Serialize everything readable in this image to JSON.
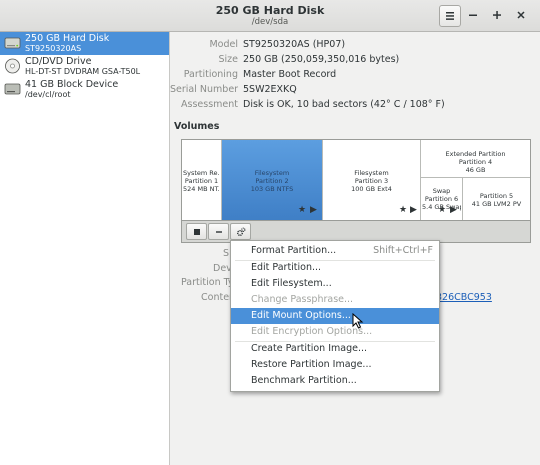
{
  "titlebar": {
    "title": "250 GB Hard Disk",
    "subtitle": "/dev/sda",
    "menu_icon": "hamburger-icon",
    "minimize_icon": "minimize-icon",
    "maximize_icon": "maximize-icon",
    "close_icon": "close-icon"
  },
  "sidebar": {
    "drives": [
      {
        "name": "250 GB Hard Disk",
        "sub": "ST9250320AS",
        "icon": "hard-disk-icon",
        "selected": true
      },
      {
        "name": "CD/DVD Drive",
        "sub": "HL-DT-ST DVDRAM GSA-T50L",
        "icon": "optical-disc-icon"
      },
      {
        "name": "41 GB Block Device",
        "sub": "/dev/cl/root",
        "icon": "block-device-icon"
      }
    ]
  },
  "drive_info": {
    "model_label": "Model",
    "model": "ST9250320AS (HP07)",
    "size_label": "Size",
    "size": "250 GB (250,059,350,016 bytes)",
    "partitioning_label": "Partitioning",
    "partitioning": "Master Boot Record",
    "serial_label": "Serial Number",
    "serial": "5SW2EXKQ",
    "assessment_label": "Assessment",
    "assessment": "Disk is OK, 10 bad sectors (42° C / 108° F)"
  },
  "volumes": {
    "heading": "Volumes",
    "partitions": [
      {
        "line1": "System Re...",
        "line2": "Partition 1",
        "line3": "524 MB NT..."
      },
      {
        "line1": "Filesystem",
        "line2": "Partition 2",
        "line3": "103 GB NTFS",
        "selected": true
      },
      {
        "line1": "Filesystem",
        "line2": "Partition 3",
        "line3": "100 GB Ext4"
      },
      {
        "line1": "Extended Partition",
        "line2": "Partition 4",
        "line3": "46 GB"
      },
      {
        "line1": "Swap",
        "line2": "Partition 6",
        "line3": "5.4 GB Swap"
      },
      {
        "line1": "Partition 5",
        "line2": "41 GB LVM2 PV"
      }
    ],
    "tools": {
      "stop_icon": "stop-icon",
      "remove_icon": "minus-icon",
      "settings_icon": "gears-icon"
    }
  },
  "partition_info": {
    "size_label_partial": "S",
    "device_label_partial": "Devi",
    "type_label_partial": "Partition Ty",
    "contents_label_partial": "Conter",
    "uuid_partial": "326CBC953"
  },
  "context_menu": {
    "items": [
      {
        "label": "Format Partition...",
        "accel": "Shift+Ctrl+F"
      },
      {
        "label": "Edit Partition..."
      },
      {
        "label": "Edit Filesystem..."
      },
      {
        "label": "Change Passphrase...",
        "disabled": true
      },
      {
        "label": "Edit Mount Options...",
        "highlighted": true
      },
      {
        "label": "Edit Encryption Options...",
        "disabled": true
      },
      {
        "label": "Create Partition Image..."
      },
      {
        "label": "Restore Partition Image..."
      },
      {
        "label": "Benchmark Partition..."
      }
    ]
  },
  "colors": {
    "accent": "#4a90d9",
    "selected_partition": "#3f7fc6",
    "link": "#1c5fb8"
  }
}
